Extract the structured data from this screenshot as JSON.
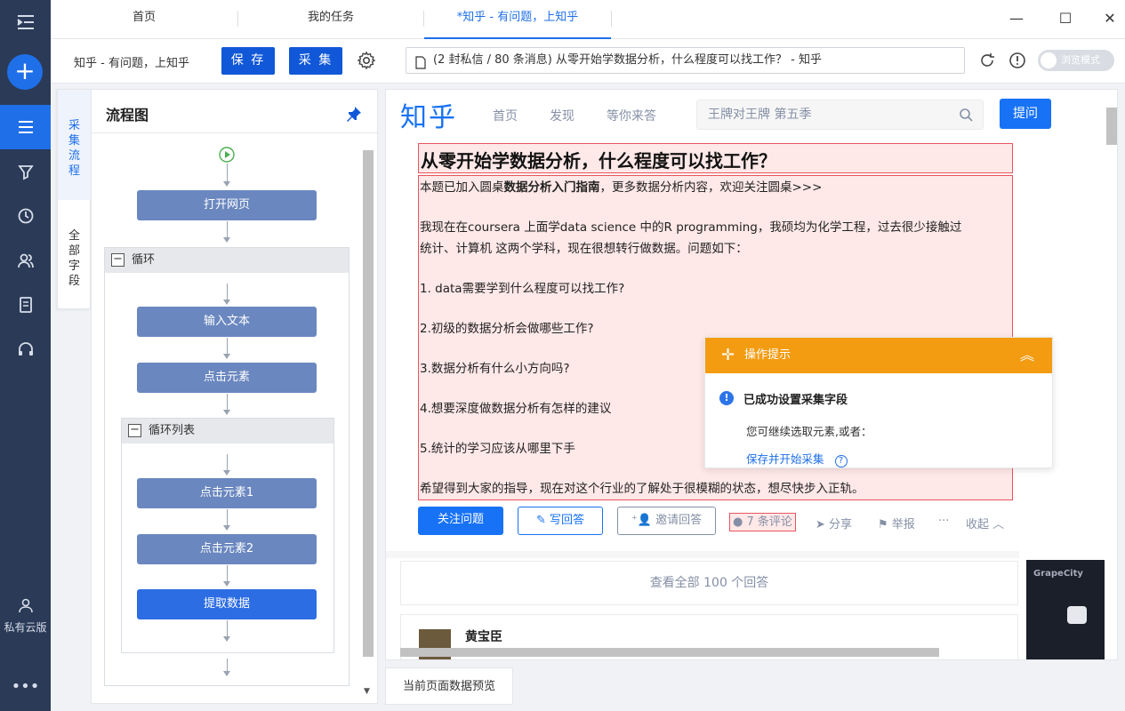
{
  "sidebar": {
    "bottom_label": "私有云版",
    "more": "•••"
  },
  "tabs": [
    {
      "label": "首页"
    },
    {
      "label": "我的任务"
    },
    {
      "label": "*知乎 - 有问题，上知乎"
    }
  ],
  "toolbar": {
    "page_title": "知乎 - 有问题，上知乎",
    "save_label": "保 存",
    "collect_label": "采 集",
    "url_text": "(2 封私信 / 80 条消息) 从零开始学数据分析，什么程度可以找工作？ - 知乎",
    "browse_mode_label": "浏览模式"
  },
  "side_tabs": {
    "collect_flow": "采集流程",
    "all_fields": "全部字段"
  },
  "flow": {
    "title": "流程图",
    "open_page": "打开网页",
    "loop_label": "循环",
    "input_text": "输入文本",
    "click_element": "点击元素",
    "loop_list_label": "循环列表",
    "click_element_1": "点击元素1",
    "click_element_2": "点击元素2",
    "extract_data": "提取数据",
    "collapse_symbol": "−"
  },
  "zhihu": {
    "logo": "知乎",
    "nav": [
      "首页",
      "发现",
      "等你来答"
    ],
    "search_placeholder": "王牌对王牌 第五季",
    "ask_button": "提问",
    "question_title": "从零开始学数据分析，什么程度可以找工作？",
    "body": {
      "intro_prefix": "本题已加入圆桌",
      "intro_bold": "数据分析入门指南",
      "intro_suffix": "，更多数据分析内容，欢迎关注圆桌>>>",
      "p1_line1": "我现在在coursera 上面学data science 中的R programming，我硕均为化学工程，过去很少接触过",
      "p1_line2": "统计、计算机 这两个学科，现在很想转行做数据。问题如下：",
      "q1": "1. data需要学到什么程度可以找工作?",
      "q2": "2.初级的数据分析会做哪些工作?",
      "q3": "3.数据分析有什么小方向吗?",
      "q4": "4.想要深度做数据分析有怎样的建议",
      "q5": "5.统计的学习应该从哪里下手",
      "closing": "希望得到大家的指导，现在对这个行业的了解处于很模糊的状态，想尽快步入正轨。"
    },
    "actions": {
      "follow": "关注问题",
      "write_answer": "写回答",
      "invite": "邀请回答",
      "comments": "7 条评论",
      "share": "分享",
      "report": "举报",
      "more": "···",
      "collapse": "收起"
    },
    "view_all_answers": "查看全部 100 个回答",
    "answer_author": "黄宝臣",
    "ad_brand": "GrapeCity"
  },
  "tip": {
    "header": "操作提示",
    "success": "已成功设置采集字段",
    "note": "您可继续选取元素,或者：",
    "save_start": "保存并开始采集"
  },
  "preview_tab": "当前页面数据预览"
}
